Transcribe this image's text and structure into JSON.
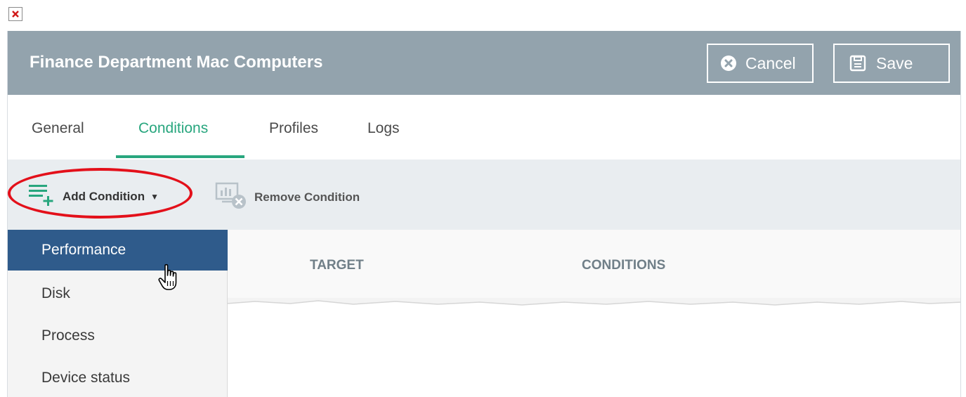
{
  "header": {
    "title": "Finance Department Mac Computers",
    "cancel_label": "Cancel",
    "save_label": "Save",
    "bg_color": "#93a3ad"
  },
  "tabs": [
    {
      "label": "General",
      "active": false
    },
    {
      "label": "Conditions",
      "active": true
    },
    {
      "label": "Profiles",
      "active": false
    },
    {
      "label": "Logs",
      "active": false
    }
  ],
  "toolbar": {
    "add_condition_label": "Add Condition",
    "remove_condition_label": "Remove Condition",
    "add_icon": "list-add-icon",
    "remove_icon": "remove-condition-icon"
  },
  "table": {
    "columns": [
      "TARGET",
      "CONDITIONS"
    ]
  },
  "dropdown": {
    "items": [
      {
        "label": "Performance",
        "active": true
      },
      {
        "label": "Disk",
        "active": false
      },
      {
        "label": "Process",
        "active": false
      },
      {
        "label": "Device status",
        "active": false
      }
    ]
  },
  "colors": {
    "accent": "#28a67e",
    "selected": "#2f5b8b",
    "highlight": "#e3101a"
  }
}
